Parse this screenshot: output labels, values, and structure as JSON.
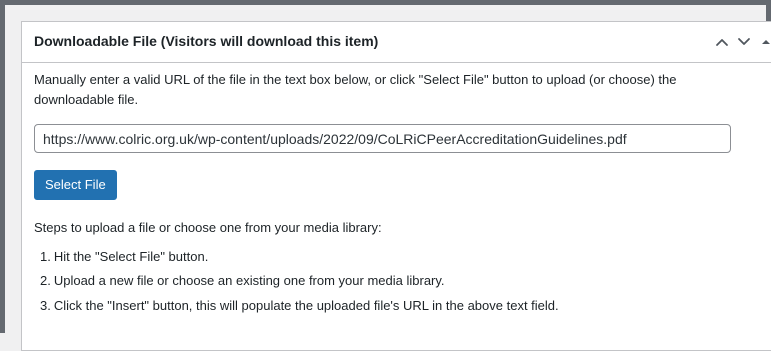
{
  "metabox": {
    "title": "Downloadable File (Visitors will download this item)",
    "controls": {
      "move_up": "move-up-icon",
      "move_down": "move-down-icon",
      "toggle": "toggle-panel-icon"
    },
    "description": "Manually enter a valid URL of the file in the text box below, or click \"Select File\" button to upload (or choose) the downloadable file.",
    "file_url": "https://www.colric.org.uk/wp-content/uploads/2022/09/CoLRiCPeerAccreditationGuidelines.pdf",
    "select_button_label": "Select File",
    "steps_heading": "Steps to upload a file or choose one from your media library:",
    "steps": [
      {
        "num": "1.",
        "text": "Hit the \"Select File\" button."
      },
      {
        "num": "2.",
        "text": "Upload a new file or choose an existing one from your media library."
      },
      {
        "num": "3.",
        "text": "Click the \"Insert\" button, this will populate the uploaded file's URL in the above text field."
      }
    ]
  },
  "colors": {
    "primary_button": "#2271b1",
    "border": "#c3c4c7",
    "frame": "#646970",
    "text": "#1d2327"
  }
}
